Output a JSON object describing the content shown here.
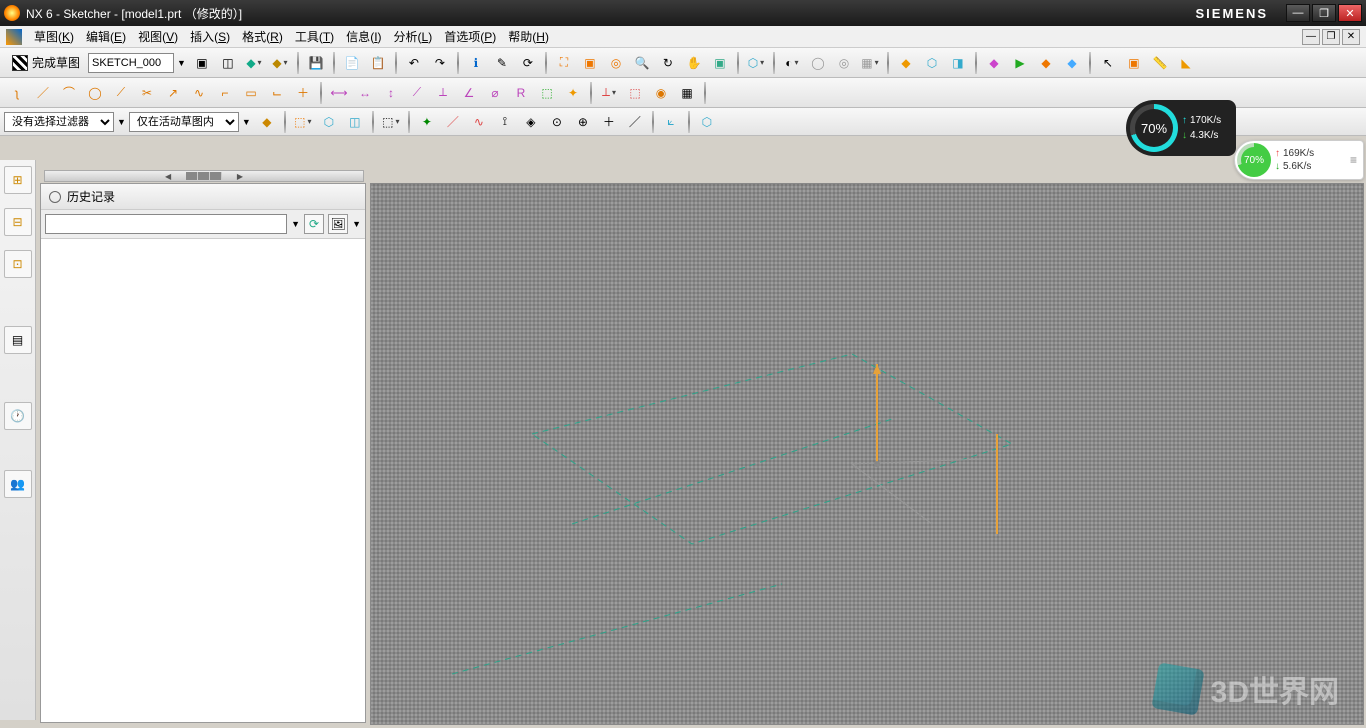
{
  "app": {
    "title": "NX 6 - Sketcher - [model1.prt （修改的）]",
    "brand": "SIEMENS"
  },
  "menu": {
    "items": [
      {
        "label": "草图",
        "key": "K"
      },
      {
        "label": "编辑",
        "key": "E"
      },
      {
        "label": "视图",
        "key": "V"
      },
      {
        "label": "插入",
        "key": "S"
      },
      {
        "label": "格式",
        "key": "R"
      },
      {
        "label": "工具",
        "key": "T"
      },
      {
        "label": "信息",
        "key": "I"
      },
      {
        "label": "分析",
        "key": "L"
      },
      {
        "label": "首选项",
        "key": "P"
      },
      {
        "label": "帮助",
        "key": "H"
      }
    ]
  },
  "toolbar1": {
    "finish_sketch": "完成草图",
    "sketch_name": "SKETCH_000"
  },
  "toolbar4": {
    "filter_label": "没有选择过滤器",
    "scope_label": "仅在活动草图内"
  },
  "panel": {
    "history_title": "历史记录"
  },
  "overlay1": {
    "percent": "70%",
    "up": "170K/s",
    "down": "4.3K/s"
  },
  "overlay2": {
    "percent": "70%",
    "up": "169K/s",
    "down": "5.6K/s"
  },
  "watermark": {
    "text": "3D世界网"
  },
  "icons": {
    "save": "💾",
    "new": "📄",
    "open": "📂",
    "undo": "↶",
    "redo": "↷",
    "info": "ℹ",
    "edit": "✎",
    "zoom-fit": "⛶",
    "zoom-area": "🔍",
    "zoom-dyn": "🔍",
    "rotate": "↻",
    "pan": "✋",
    "box": "▦",
    "cube": "▣",
    "shade": "◐",
    "wire": "◯",
    "gray": "▦",
    "line": "／",
    "arc": "⌒",
    "circle": "◯",
    "rect": "▭",
    "point": "＋",
    "spline": "∿",
    "fillet": "⌐",
    "chamfer": "◣",
    "trim": "✂",
    "extend": "↔",
    "mirror": "⇋",
    "offset": "≡",
    "dim": "⟷",
    "constraint": "⟂",
    "par": "∥",
    "horiz": "—",
    "vert": "|",
    "tan": "⊙",
    "equal": "＝",
    "coin": "⊕",
    "mid": "◈",
    "refresh": "⟳",
    "pic": "🖼",
    "gear": "⚙",
    "clock": "🕐",
    "users": "👥",
    "tree": "🌳",
    "layer": "≣",
    "axis": "✦",
    "play": "▶",
    "orange": "◆",
    "green": "◆",
    "blue": "◆",
    "cross": "✕",
    "plus": "＋",
    "anchor": "⚓",
    "tag": "🏷",
    "check": "✓",
    "sel": "▭",
    "cursor": "↖",
    "lasso": "◯"
  }
}
